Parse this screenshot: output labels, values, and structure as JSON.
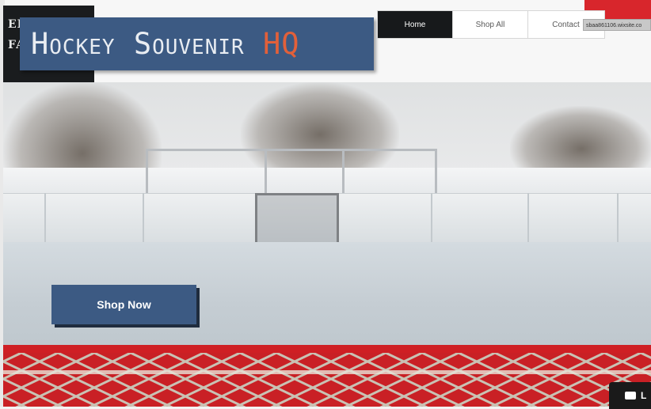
{
  "header": {
    "dark_lines": [
      "ER",
      "FA"
    ],
    "logo_main": "Hockey Souvenir ",
    "logo_accent": "HQ"
  },
  "nav": {
    "items": [
      {
        "label": "Home",
        "active": true
      },
      {
        "label": "Shop All",
        "active": false
      },
      {
        "label": "Contact",
        "active": false
      }
    ]
  },
  "url_text": "sbaa861106.wixsite.co",
  "hero": {
    "cta_label": "Shop Now"
  },
  "chat": {
    "label": "L"
  },
  "colors": {
    "brand_blue": "#3c5a83",
    "accent_orange": "#e2603a",
    "net_red": "#cf1f24"
  }
}
